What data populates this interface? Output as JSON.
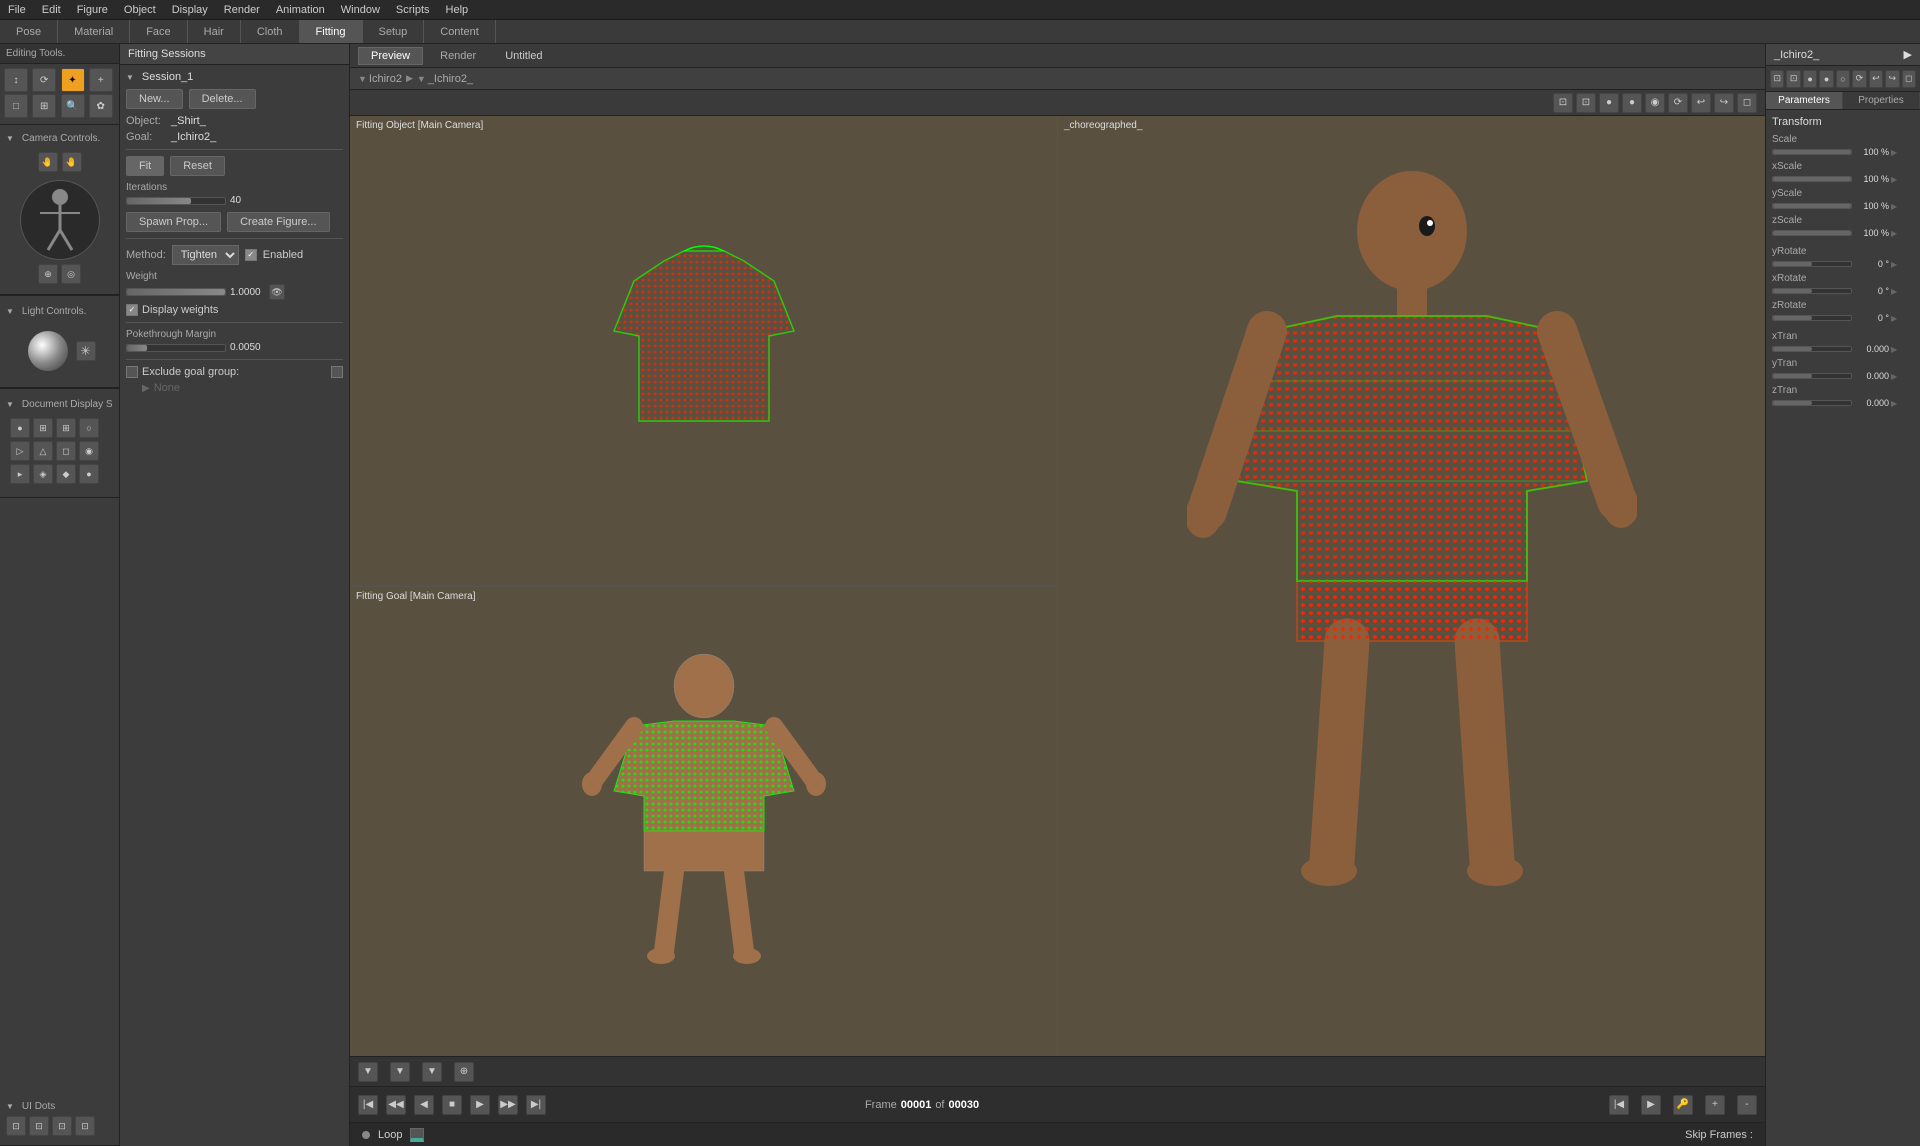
{
  "menu": {
    "items": [
      "File",
      "Edit",
      "Figure",
      "Object",
      "Display",
      "Render",
      "Animation",
      "Window",
      "Scripts",
      "Help"
    ]
  },
  "tabs": {
    "items": [
      "Pose",
      "Material",
      "Face",
      "Hair",
      "Cloth",
      "Fitting",
      "Setup",
      "Content"
    ]
  },
  "viewport": {
    "tabs": [
      "Preview",
      "Render"
    ],
    "active_tab": "Preview",
    "title": "Untitled",
    "breadcrumb_root": "Ichiro2",
    "breadcrumb_child": "_Ichiro2_",
    "top_left_label": "Fitting Object [Main Camera]",
    "bottom_left_label": "Fitting Goal [Main Camera]",
    "right_label": "_choreographed_"
  },
  "fitting_panel": {
    "title": "Fitting Sessions",
    "session_name": "Session_1",
    "new_label": "New...",
    "delete_label": "Delete...",
    "object_label": "Object:",
    "object_value": "_Shirt_",
    "goal_label": "Goal:",
    "goal_value": "_Ichiro2_",
    "fit_label": "Fit",
    "reset_label": "Reset",
    "iterations_label": "Iterations",
    "iterations_value": "40",
    "spawn_prop_label": "Spawn Prop...",
    "create_figure_label": "Create Figure...",
    "method_label": "Method:",
    "method_value": "Tighten",
    "enabled_label": "Enabled",
    "weight_label": "Weight",
    "weight_value": "1.0000",
    "display_weights_label": "Display weights",
    "pokethrough_label": "Pokethrough Margin",
    "pokethrough_value": "0.0050",
    "exclude_group_label": "Exclude goal group:",
    "none_label": "None"
  },
  "editing_tools": {
    "title": "Editing Tools."
  },
  "camera_controls": {
    "title": "Camera Controls."
  },
  "light_controls": {
    "title": "Light Controls."
  },
  "document_display": {
    "title": "Document Display S"
  },
  "ui_dots": {
    "title": "UI Dots"
  },
  "right_panel": {
    "title": "_Ichiro2_",
    "params_tab": "Parameters",
    "properties_tab": "Properties",
    "transform_title": "Transform",
    "scale_label": "Scale",
    "scale_value": "100 %",
    "xscale_label": "xScale",
    "xscale_value": "100 %",
    "yscale_label": "yScale",
    "yscale_value": "100 %",
    "zscale_label": "zScale",
    "zscale_value": "100 %",
    "yrotate_label": "yRotate",
    "yrotate_value": "0 °",
    "xrotate_label": "xRotate",
    "xrotate_value": "0 °",
    "zrotate_label": "zRotate",
    "zrotate_value": "0 °",
    "xtran_label": "xTran",
    "xtran_value": "0.000",
    "ytran_label": "yTran",
    "ytran_value": "0.000",
    "ztran_label": "zTran",
    "ztran_value": "0.000"
  },
  "timeline": {
    "frame_label": "Frame",
    "frame_current": "00001",
    "frame_of": "of",
    "frame_total": "00030",
    "loop_label": "Loop",
    "skip_label": "Skip Frames :"
  }
}
